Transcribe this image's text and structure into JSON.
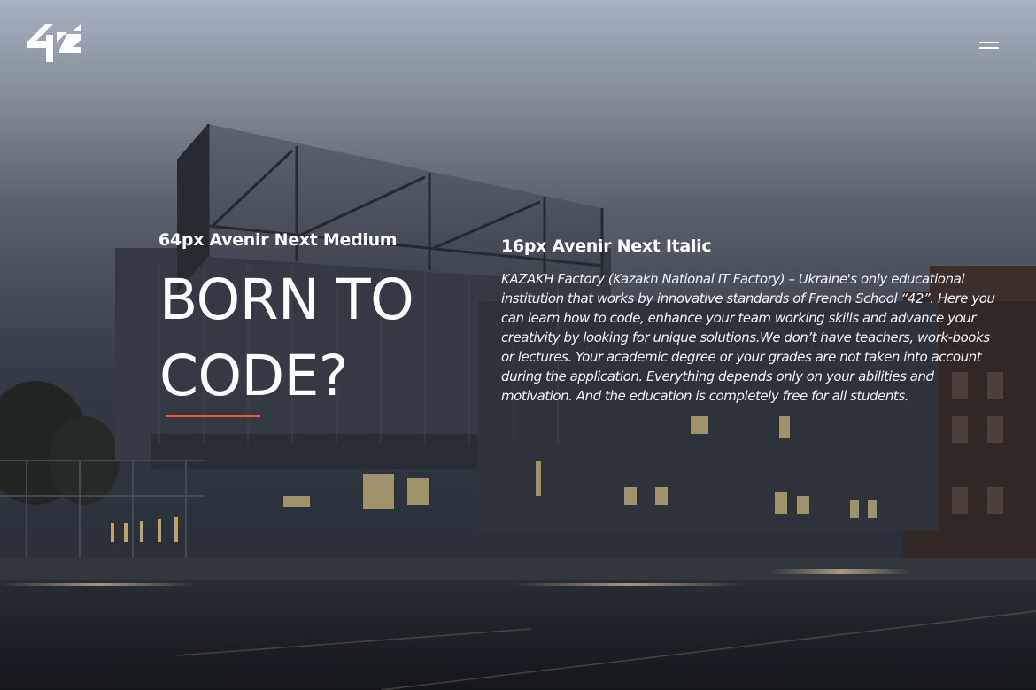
{
  "header": {
    "logo_icon": "42-logo-icon",
    "menu_icon": "hamburger-menu-icon"
  },
  "hero": {
    "left_caption": "64px Avenir Next Medium",
    "title": "BORN TO CODE?",
    "right_caption": "16px Avenir Next Italic",
    "description": "KAZAKH Factory (Kazakh National IT Factory) – Ukraine's only educational institution that works by innovative standards of French School “42”. Here you can learn how to code, enhance your team working skills and advance your creativity by looking for unique solutions.We don’t have teachers, work-books or lectures. Your academic degree or your grades are not taken into account during the application. Everything depends only on your abilities and motivation. And the education is completely free for all students."
  },
  "colors": {
    "accent": "#ea5a3f",
    "text": "#ffffff",
    "sky_top": "#c9d5e6",
    "sky_bottom": "#3c4350"
  }
}
